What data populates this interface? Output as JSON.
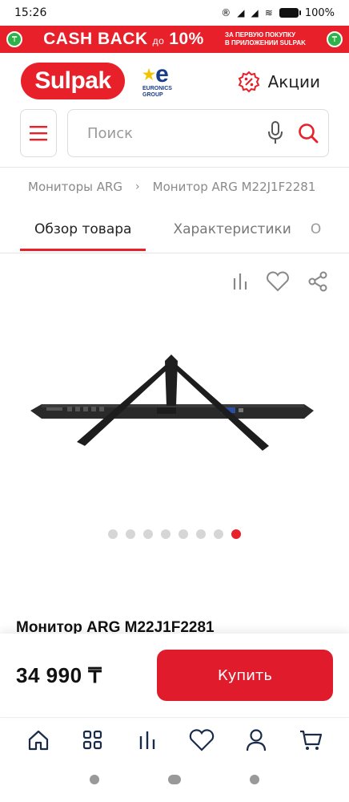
{
  "status_bar": {
    "time": "15:26",
    "battery": "100%"
  },
  "promo": {
    "main": "CASH BACK",
    "do": "до",
    "percent": "10%",
    "sub_line1": "ЗА ПЕРВУЮ ПОКУПКУ",
    "sub_line2": "В ПРИЛОЖЕНИИ SULPAK"
  },
  "header": {
    "logo": "Sulpak",
    "partner_line1": "EURONICS",
    "partner_line2": "GROUP",
    "promos_label": "Акции"
  },
  "search": {
    "placeholder": "Поиск"
  },
  "breadcrumb": {
    "items": [
      "Мониторы ARG",
      "Монитор ARG M22J1F2281"
    ]
  },
  "tabs": [
    {
      "label": "Обзор товара"
    },
    {
      "label": "Характеристики"
    },
    {
      "label": "О"
    }
  ],
  "gallery": {
    "dots_total": 8,
    "active_index": 7
  },
  "product": {
    "title": "Монитор ARG M22J1F2281"
  },
  "buy": {
    "price": "34 990 ₸",
    "button_label": "Купить"
  },
  "colors": {
    "accent": "#e8202a",
    "inactive_dot": "#d6d6d6"
  },
  "bottom_nav": [
    "home-icon",
    "catalog-icon",
    "compare-icon",
    "favorites-icon",
    "profile-icon",
    "cart-icon"
  ]
}
